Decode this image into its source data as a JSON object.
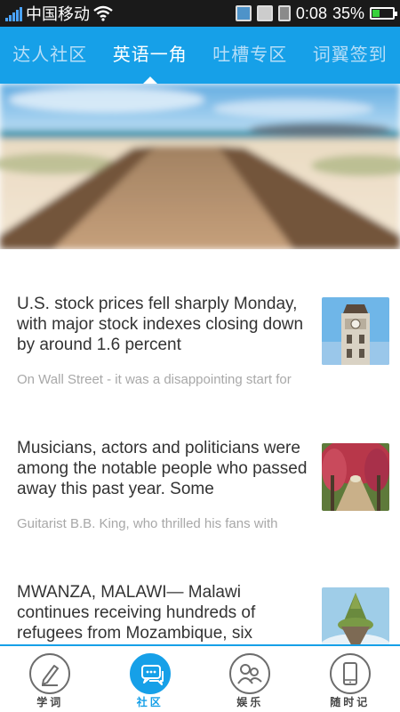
{
  "status_bar": {
    "carrier": "中国移动",
    "time": "0:08",
    "battery_percent": "35%",
    "battery_level": 0.35,
    "icons": [
      "signal-icon",
      "wifi-icon",
      "app-notification-icon",
      "gallery-notification-icon",
      "sd-card-icon",
      "battery-icon"
    ]
  },
  "tabs": [
    {
      "label": "达人社区",
      "active": false
    },
    {
      "label": "英语一角",
      "active": true
    },
    {
      "label": "吐槽专区",
      "active": false
    },
    {
      "label": "词翼签到",
      "active": false
    }
  ],
  "articles": [
    {
      "headline": "U.S. stock prices fell sharply Monday, with major stock indexes closing down by around 1.6 percent",
      "excerpt": "On Wall Street - it was a disappointing start for",
      "thumbnail": "clock-tower"
    },
    {
      "headline": "Musicians, actors and politicians were among the notable people who passed away this past year. Some",
      "excerpt": "Guitarist B.B. King, who thrilled his fans with",
      "thumbnail": "flower-arch-path"
    },
    {
      "headline": "MWANZA, MALAWI— Malawi continues receiving hundreds of refugees from Mozambique, six",
      "excerpt": "",
      "thumbnail": "floating-island"
    }
  ],
  "bottom_nav": [
    {
      "label": "学词",
      "icon": "pen-icon",
      "active": false
    },
    {
      "label": "社区",
      "icon": "chat-bubbles-icon",
      "active": true
    },
    {
      "label": "娱乐",
      "icon": "people-icon",
      "active": false
    },
    {
      "label": "随时记",
      "icon": "phone-icon",
      "active": false
    }
  ],
  "colors": {
    "accent": "#16a0e8",
    "status_bar": "#1a1a1a",
    "headline_text": "#333333",
    "excerpt_text": "#a8a8a8"
  }
}
